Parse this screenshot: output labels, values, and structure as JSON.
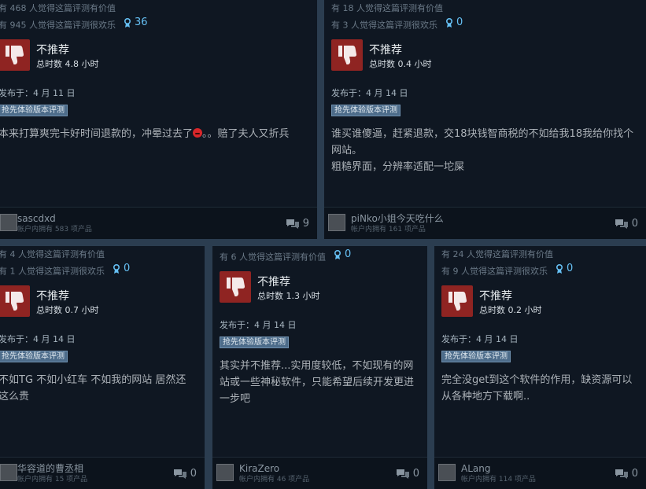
{
  "reviews": [
    {
      "helpful": "有 468 人觉得这篇评测有价值",
      "funny": "有 945 人觉得这篇评测很欢乐",
      "awards": "36",
      "recommendation": "不推荐",
      "hours": "总时数 4.8 小时",
      "posted": "发布于：4 月 11 日",
      "badge": "抢先体验版本评测",
      "content_a": "本来打算爽完卡好时间退款的，冲晕过去了",
      "content_b": "。。赔了夫人又折兵",
      "username": "sascdxd",
      "owned": "帐户内拥有 583 项产品",
      "comments": "9"
    },
    {
      "helpful": "有 18 人觉得这篇评测有价值",
      "funny": "有 3 人觉得这篇评测很欢乐",
      "awards": "0",
      "recommendation": "不推荐",
      "hours": "总时数 0.4 小时",
      "posted": "发布于：4 月 14 日",
      "badge": "抢先体验版本评测",
      "content": "谁买谁傻逼，赶紧退款，交18块钱智商税的不如给我18我给你找个网站。\n粗糙界面，分辨率适配一坨屎",
      "username": "piNko小姐今天吃什么",
      "owned": "帐户内拥有 161 项产品",
      "comments": "0"
    },
    {
      "helpful": "有 4 人觉得这篇评测有价值",
      "funny": "有 1 人觉得这篇评测很欢乐",
      "awards": "0",
      "recommendation": "不推荐",
      "hours": "总时数 0.7 小时",
      "posted": "发布于：4 月 14 日",
      "badge": "抢先体验版本评测",
      "content": "不如TG 不如小红车 不如我的网站 居然还这么贵",
      "username": "华容道的曹丞相",
      "owned": "帐户内拥有 15 项产品",
      "comments": "0"
    },
    {
      "helpful": "有 6 人觉得这篇评测有价值",
      "awards": "0",
      "recommendation": "不推荐",
      "hours": "总时数 1.3 小时",
      "posted": "发布于：4 月 14 日",
      "badge": "抢先体验版本评测",
      "content": "其实并不推荐...实用度较低，不如现有的网站或一些神秘软件，只能希望后续开发更进一步吧",
      "username": "KiraZero",
      "owned": "帐户内拥有 46 项产品",
      "comments": "0"
    },
    {
      "helpful": "有 24 人觉得这篇评测有价值",
      "funny": "有 9 人觉得这篇评测很欢乐",
      "awards": "0",
      "recommendation": "不推荐",
      "hours": "总时数 0.2 小时",
      "posted": "发布于：4 月 14 日",
      "badge": "抢先体验版本评测",
      "content": "完全没get到这个软件的作用，缺资源可以从各种地方下载啊..",
      "username": "ALang",
      "owned": "帐户内拥有 114 项产品",
      "comments": "0"
    }
  ],
  "icons": {
    "thumb": "thumbs-down-icon",
    "award": "award-ribbon-icon",
    "comment": "comment-bubbles-icon"
  },
  "colors": {
    "background": "#2b3d50",
    "card": "#0f1722",
    "thumb_red": "#8f2422",
    "award_blue": "#66c0f4",
    "badge": "#4d6c8a"
  }
}
